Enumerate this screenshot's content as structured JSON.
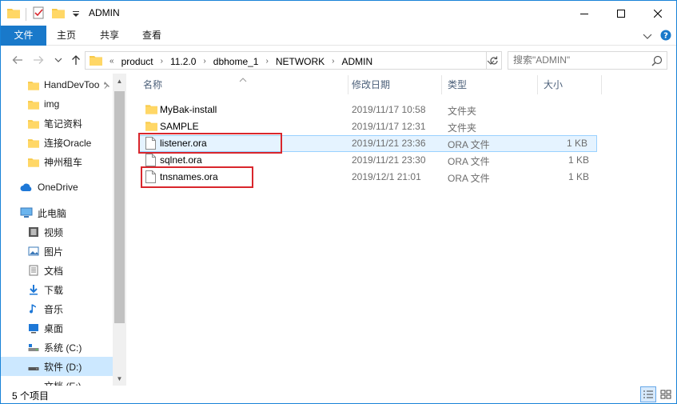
{
  "window": {
    "title": "ADMIN",
    "folder_color": "#f7c948",
    "accent": "#1979ca"
  },
  "ribbon": {
    "tabs": [
      "文件",
      "主页",
      "共享",
      "查看"
    ]
  },
  "address": {
    "overflow": "«",
    "crumbs": [
      "product",
      "11.2.0",
      "dbhome_1",
      "NETWORK",
      "ADMIN"
    ]
  },
  "search": {
    "placeholder": "搜索\"ADMIN\""
  },
  "nav": {
    "items": [
      {
        "label": "HandDevToo",
        "icon": "folder-icon",
        "pinned": true
      },
      {
        "label": "img",
        "icon": "folder-icon"
      },
      {
        "label": "笔记资料",
        "icon": "folder-icon"
      },
      {
        "label": "连接Oracle",
        "icon": "folder-icon"
      },
      {
        "label": "神州租车",
        "icon": "folder-icon"
      },
      {
        "label": "OneDrive",
        "icon": "cloud-icon"
      },
      {
        "label": "此电脑",
        "icon": "computer-icon"
      },
      {
        "label": "视频",
        "icon": "video-icon"
      },
      {
        "label": "图片",
        "icon": "pictures-icon"
      },
      {
        "label": "文档",
        "icon": "documents-icon"
      },
      {
        "label": "下载",
        "icon": "download-icon"
      },
      {
        "label": "音乐",
        "icon": "music-icon"
      },
      {
        "label": "桌面",
        "icon": "desktop-icon"
      },
      {
        "label": "系统 (C:)",
        "icon": "drive-icon"
      },
      {
        "label": "软件 (D:)",
        "icon": "drive-icon",
        "selected": true
      },
      {
        "label": "文档 (E:)",
        "icon": "drive-icon"
      }
    ]
  },
  "columns": {
    "name": "名称",
    "date": "修改日期",
    "type": "类型",
    "size": "大小"
  },
  "files": [
    {
      "name": "MyBak-install",
      "date": "2019/11/17 10:58",
      "type": "文件夹",
      "size": "",
      "kind": "folder"
    },
    {
      "name": "SAMPLE",
      "date": "2019/11/17 12:31",
      "type": "文件夹",
      "size": "",
      "kind": "folder"
    },
    {
      "name": "listener.ora",
      "date": "2019/11/21 23:36",
      "type": "ORA 文件",
      "size": "1 KB",
      "kind": "file",
      "hover": true,
      "highlight": true
    },
    {
      "name": "sqlnet.ora",
      "date": "2019/11/21 23:30",
      "type": "ORA 文件",
      "size": "1 KB",
      "kind": "file"
    },
    {
      "name": "tnsnames.ora",
      "date": "2019/12/1 21:01",
      "type": "ORA 文件",
      "size": "1 KB",
      "kind": "file",
      "highlight": true
    }
  ],
  "status": {
    "count": "5 个项目"
  }
}
